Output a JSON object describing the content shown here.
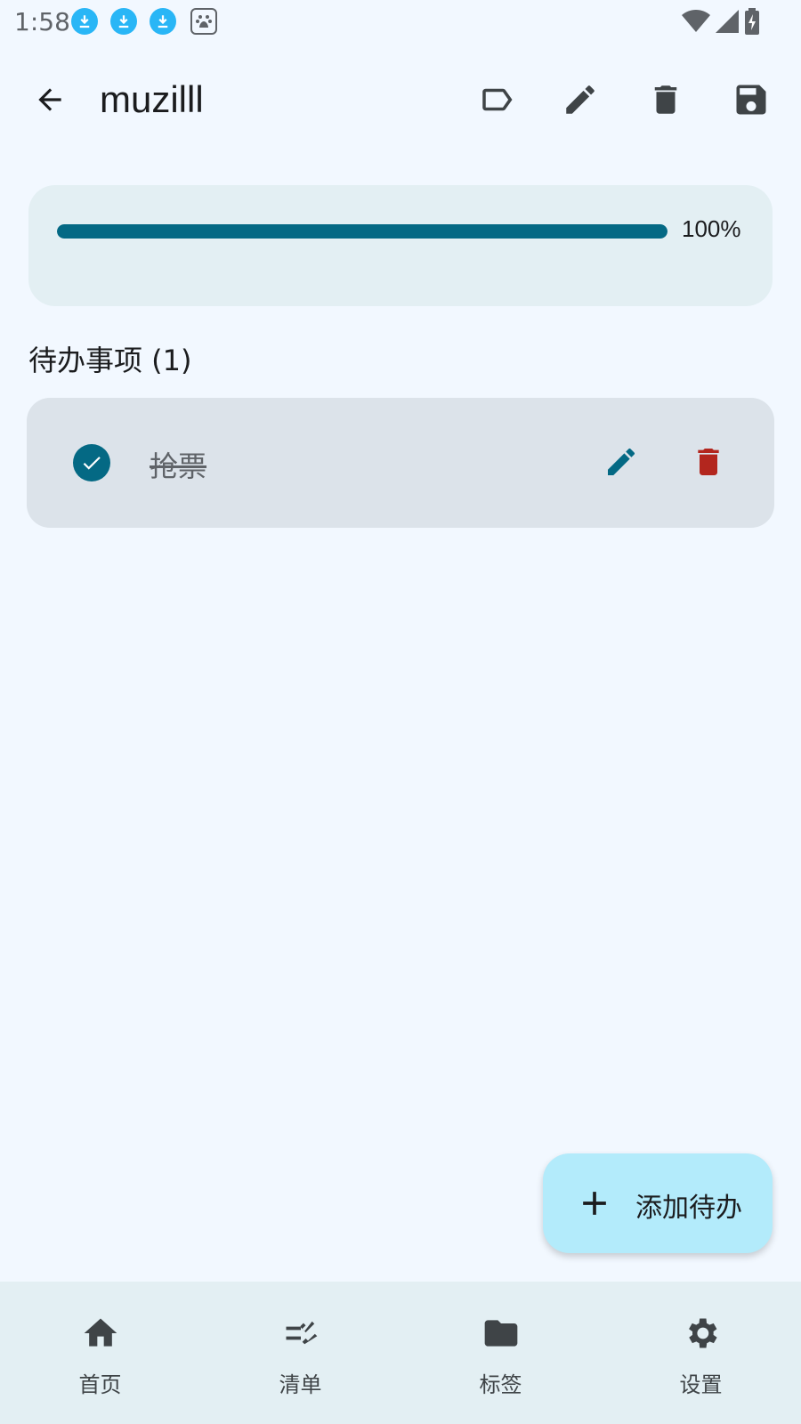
{
  "status_bar": {
    "time": "1:58",
    "icons": [
      "download-icon",
      "download-icon",
      "download-icon",
      "baidu-icon"
    ],
    "system_icons": [
      "wifi-icon",
      "signal-icon",
      "battery-charging-icon"
    ]
  },
  "app_bar": {
    "title": "muzilll",
    "actions": [
      "label-icon",
      "edit-icon",
      "delete-icon",
      "save-icon"
    ]
  },
  "progress": {
    "value": 1.0,
    "text": "100%"
  },
  "section": {
    "title": "待办事项 (1)"
  },
  "todos": [
    {
      "text": "抢票",
      "done": true
    }
  ],
  "fab": {
    "label": "添加待办"
  },
  "bottom_nav": [
    {
      "label": "首页",
      "icon": "home-icon"
    },
    {
      "label": "清单",
      "icon": "checklist-icon"
    },
    {
      "label": "标签",
      "icon": "folder-icon"
    },
    {
      "label": "设置",
      "icon": "settings-icon"
    }
  ],
  "colors": {
    "background": "#f2f8ff",
    "accent": "#046984",
    "delete_red": "#b3261e",
    "fab": "#b3ebfb",
    "card": "#e3eff3",
    "todo_card": "#dce3ea",
    "icon_gray": "#3f4447"
  }
}
